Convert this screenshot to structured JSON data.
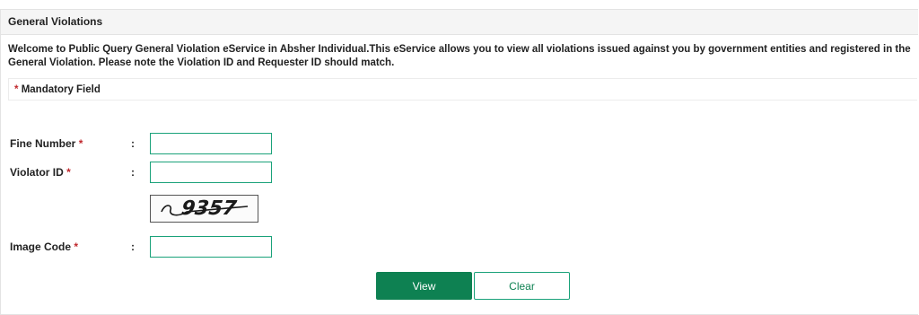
{
  "panel": {
    "title": "General Violations"
  },
  "intro": {
    "text": "Welcome to Public Query General Violation eService in Absher Individual.This eService allows you to view all violations issued against you by government entities and registered in the General Violation. Please note the Violation ID and Requester ID should match."
  },
  "mandatory": {
    "star": "*",
    "label": "Mandatory Field"
  },
  "form": {
    "fine_number": {
      "label": "Fine Number",
      "required": "*",
      "colon": ":",
      "value": ""
    },
    "violator_id": {
      "label": "Violator ID",
      "required": "*",
      "colon": ":",
      "value": ""
    },
    "captcha": {
      "text": "9357"
    },
    "image_code": {
      "label": "Image Code",
      "required": "*",
      "colon": ":",
      "value": ""
    }
  },
  "buttons": {
    "view": "View",
    "clear": "Clear"
  },
  "colors": {
    "accent": "#0e8152",
    "input_border": "#1aa27a",
    "required": "#c0282d"
  }
}
